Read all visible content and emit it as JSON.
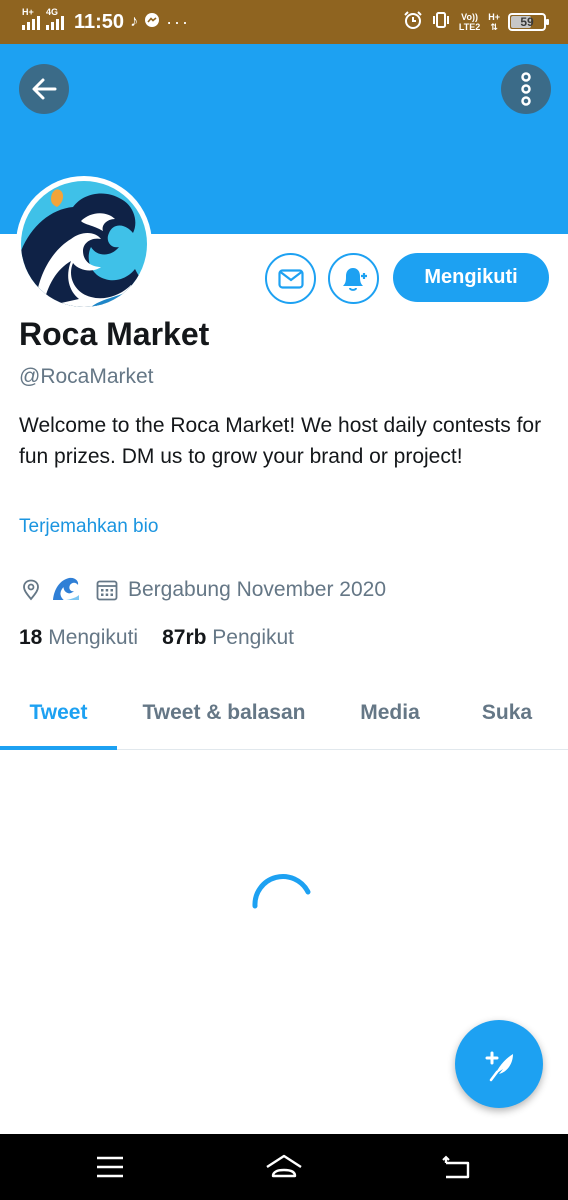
{
  "status_bar": {
    "network_1": "H+",
    "network_2": "4G",
    "time": "11:50",
    "more": "···",
    "volte_line1": "Vo))",
    "volte_line2": "LTE2",
    "net_right": "H+",
    "battery_level": "59",
    "icons": [
      "signal-icon",
      "tiktok-icon",
      "messenger-icon",
      "alarm-icon",
      "vibrate-icon",
      "battery-icon"
    ]
  },
  "profile": {
    "name": "Roca Market",
    "handle": "@RocaMarket",
    "bio": "Welcome to the Roca Market! We host daily contests for fun prizes. DM us to grow your brand or project!",
    "translate_label": "Terjemahkan bio",
    "location_emoji": "🌊",
    "joined": "Bergabung November 2020",
    "following_count": "18",
    "following_label": "Mengikuti",
    "followers_count": "87rb",
    "followers_label": "Pengikut",
    "follow_button_label": "Mengikuti"
  },
  "tabs": [
    {
      "label": "Tweet",
      "active": true
    },
    {
      "label": "Tweet & balasan",
      "active": false
    },
    {
      "label": "Media",
      "active": false
    },
    {
      "label": "Suka",
      "active": false
    }
  ],
  "colors": {
    "brand_blue": "#1da1f2",
    "status_bar": "#8f6420",
    "secondary_text": "#657786",
    "primary_text": "#14171a"
  }
}
